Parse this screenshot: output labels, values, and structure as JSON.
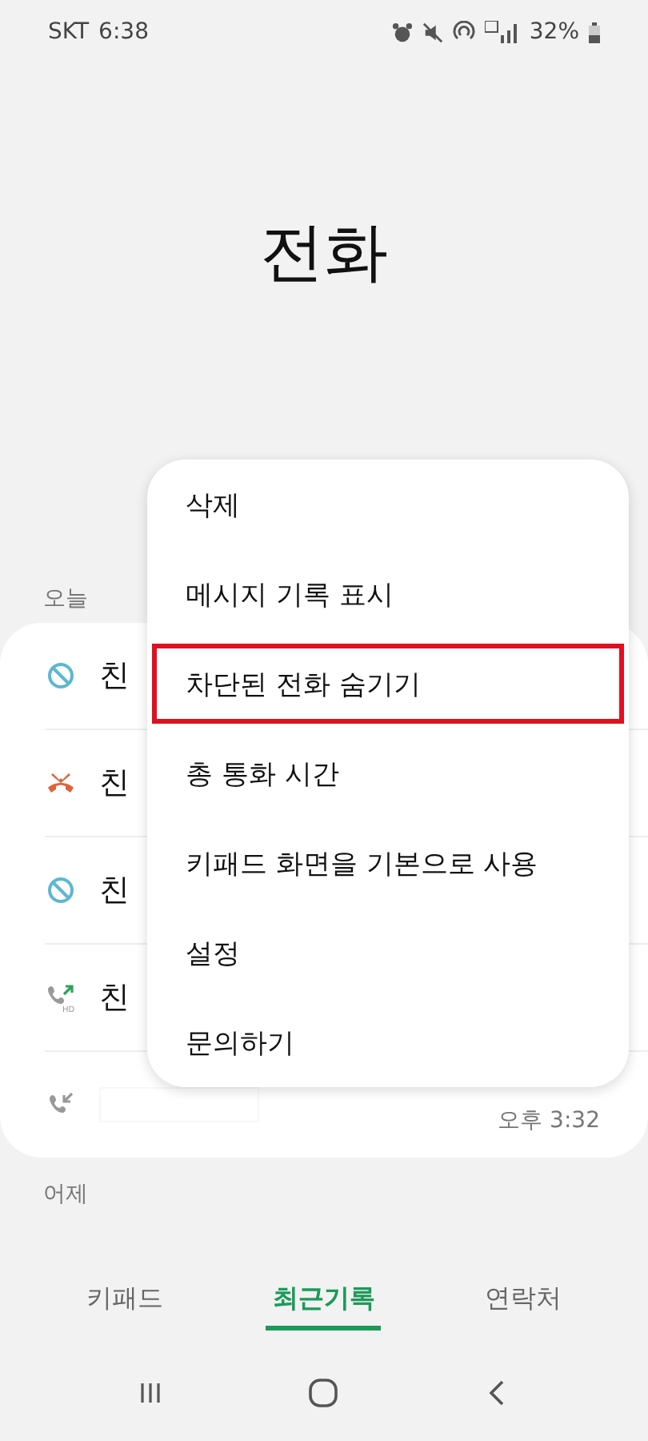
{
  "status_bar": {
    "carrier": "SKT",
    "time": "6:38",
    "battery": "32%"
  },
  "title": "전화",
  "sections": [
    {
      "label": "오늘",
      "calls": [
        {
          "kind": "blocked",
          "name": "친"
        },
        {
          "kind": "rejected",
          "name": "친"
        },
        {
          "kind": "blocked",
          "name": "친"
        },
        {
          "kind": "outgoing-hd",
          "badge": "HD",
          "name": "친"
        },
        {
          "kind": "incoming",
          "redacted": true,
          "time": "오후 3:32"
        }
      ]
    },
    {
      "label": "어제"
    }
  ],
  "menu": [
    {
      "label": "삭제",
      "highlighted": false
    },
    {
      "label": "메시지 기록 표시",
      "highlighted": false
    },
    {
      "label": "차단된 전화 숨기기",
      "highlighted": true
    },
    {
      "label": "총 통화 시간",
      "highlighted": false
    },
    {
      "label": "키패드 화면을 기본으로 사용",
      "highlighted": false
    },
    {
      "label": "설정",
      "highlighted": false
    },
    {
      "label": "문의하기",
      "highlighted": false
    }
  ],
  "tabs": [
    {
      "label": "키패드",
      "selected": false
    },
    {
      "label": "최근기록",
      "selected": true
    },
    {
      "label": "연락처",
      "selected": false
    }
  ]
}
